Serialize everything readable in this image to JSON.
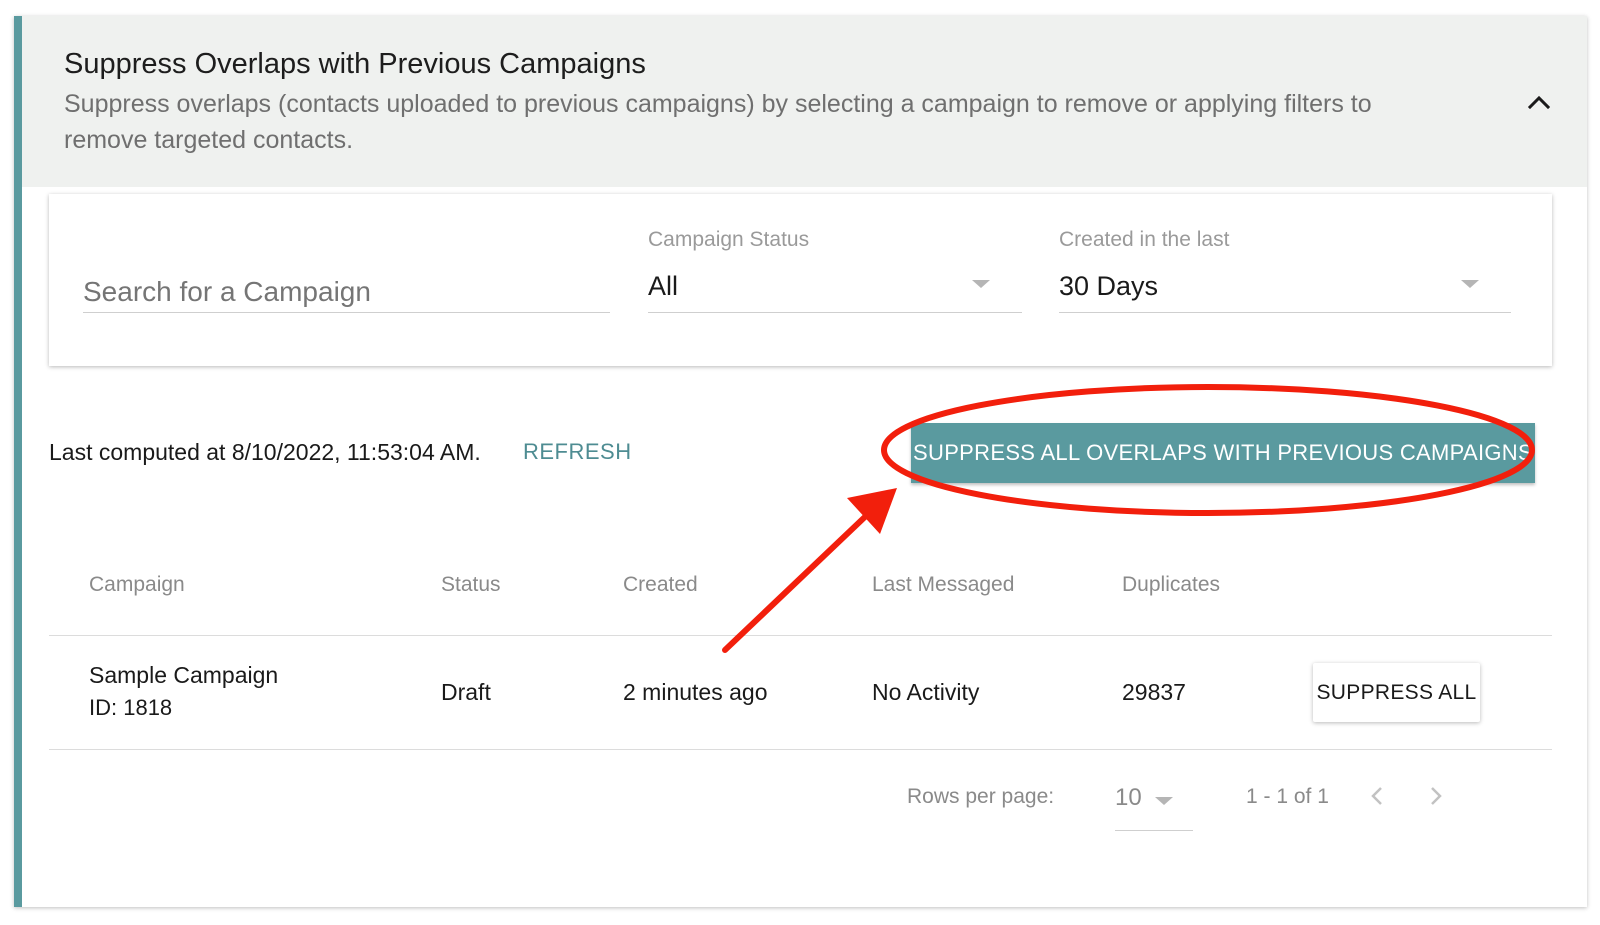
{
  "section": {
    "title": "Suppress Overlaps with Previous Campaigns",
    "subtitle": "Suppress overlaps (contacts uploaded to previous campaigns) by selecting a campaign to remove or applying filters to remove targeted contacts.",
    "collapse_icon": "chevron-up-icon"
  },
  "filters": {
    "search": {
      "placeholder": "Search for a Campaign",
      "value": ""
    },
    "campaign_status": {
      "label": "Campaign Status",
      "value": "All"
    },
    "created_in_last": {
      "label": "Created in the last",
      "value": "30 Days"
    }
  },
  "computed": {
    "text": "Last computed at 8/10/2022, 11:53:04 AM.",
    "refresh_label": "REFRESH"
  },
  "suppress_overlaps_button": {
    "label": "SUPPRESS ALL OVERLAPS WITH PREVIOUS CAMPAIGNS"
  },
  "table": {
    "headers": [
      "Campaign",
      "Status",
      "Created",
      "Last Messaged",
      "Duplicates"
    ],
    "rows": [
      {
        "campaign_name": "Sample Campaign",
        "campaign_id": "ID: 1818",
        "status": "Draft",
        "created": "2 minutes ago",
        "last_messaged": "No Activity",
        "duplicates": "29837",
        "action_label": "SUPPRESS ALL"
      }
    ]
  },
  "pagination": {
    "rows_per_page_label": "Rows per page:",
    "rows_per_page_value": "10",
    "range_text": "1 - 1 of 1",
    "prev_icon": "chevron-left-icon",
    "next_icon": "chevron-right-icon"
  },
  "colors": {
    "accent": "#5a9a9f",
    "link": "#4e8c92",
    "annotation": "#f21f0c",
    "header_bg": "#eff1ef"
  }
}
